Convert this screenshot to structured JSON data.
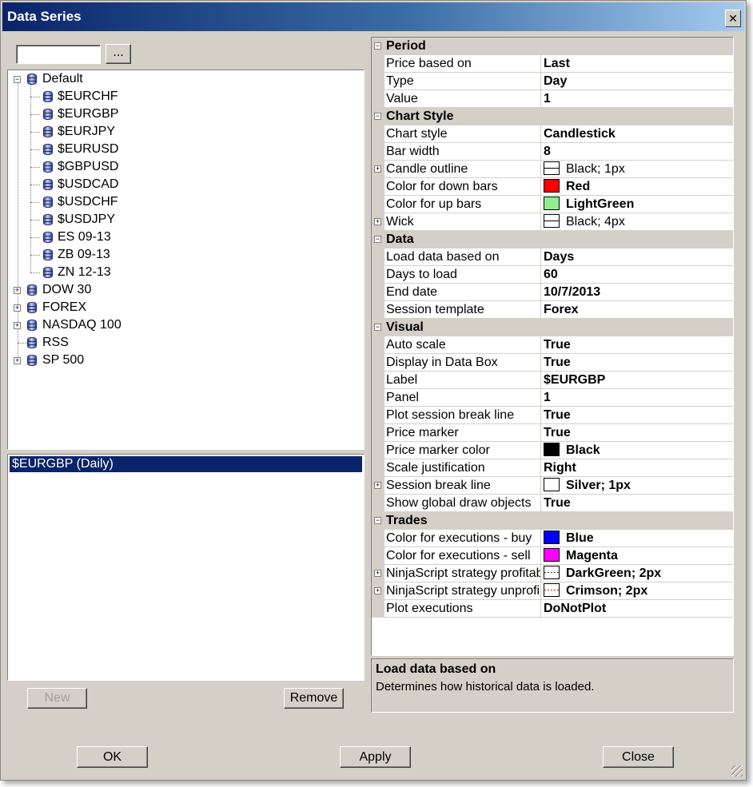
{
  "window": {
    "title": "Data Series",
    "close_glyph": "✕"
  },
  "browse_label": "...",
  "tree": {
    "expanded_group": "Default",
    "default_items": [
      "$EURCHF",
      "$EURGBP",
      "$EURJPY",
      "$EURUSD",
      "$GBPUSD",
      "$USDCAD",
      "$USDCHF",
      "$USDJPY",
      "ES 09-13",
      "ZB 09-13",
      "ZN 12-13"
    ],
    "groups": [
      {
        "label": "DOW 30",
        "expandable": true
      },
      {
        "label": "FOREX",
        "expandable": true
      },
      {
        "label": "NASDAQ 100",
        "expandable": true
      },
      {
        "label": "RSS",
        "expandable": false
      },
      {
        "label": "SP 500",
        "expandable": true
      }
    ]
  },
  "series_list": {
    "selected": "$EURGBP (Daily)"
  },
  "buttons": {
    "new": "New",
    "remove": "Remove",
    "ok": "OK",
    "apply": "Apply",
    "close": "Close"
  },
  "properties": [
    {
      "category": "Period",
      "rows": [
        {
          "name": "Price based on",
          "value": "Last"
        },
        {
          "name": "Type",
          "value": "Day"
        },
        {
          "name": "Value",
          "value": "1"
        }
      ]
    },
    {
      "category": "Chart Style",
      "rows": [
        {
          "name": "Chart style",
          "value": "Candlestick"
        },
        {
          "name": "Bar width",
          "value": "8"
        },
        {
          "name": "Candle outline",
          "value": "Black; 1px",
          "expandable": true,
          "swatch": "#ffffff",
          "line": "solid",
          "bold": false
        },
        {
          "name": "Color for down bars",
          "value": "Red",
          "swatch": "#ff0000"
        },
        {
          "name": "Color for up bars",
          "value": "LightGreen",
          "swatch": "#90ee90"
        },
        {
          "name": "Wick",
          "value": "Black; 4px",
          "expandable": true,
          "swatch": "#ffffff",
          "line": "solid",
          "bold": false
        }
      ]
    },
    {
      "category": "Data",
      "rows": [
        {
          "name": "Load data based on",
          "value": "Days"
        },
        {
          "name": "Days to load",
          "value": "60"
        },
        {
          "name": "End date",
          "value": "10/7/2013"
        },
        {
          "name": "Session template",
          "value": "Forex"
        }
      ]
    },
    {
      "category": "Visual",
      "rows": [
        {
          "name": "Auto scale",
          "value": "True"
        },
        {
          "name": "Display in Data Box",
          "value": "True"
        },
        {
          "name": "Label",
          "value": "$EURGBP"
        },
        {
          "name": "Panel",
          "value": "1"
        },
        {
          "name": "Plot session break line",
          "value": "True"
        },
        {
          "name": "Price marker",
          "value": "True"
        },
        {
          "name": "Price marker color",
          "value": "Black",
          "swatch": "#000000"
        },
        {
          "name": "Scale justification",
          "value": "Right"
        },
        {
          "name": "Session break line",
          "value": "Silver; 1px",
          "expandable": true,
          "swatch": "#ffffff",
          "line": "none"
        },
        {
          "name": "Show global draw objects",
          "value": "True"
        }
      ]
    },
    {
      "category": "Trades",
      "rows": [
        {
          "name": "Color for executions - buy",
          "value": "Blue",
          "swatch": "#0000ff"
        },
        {
          "name": "Color for executions - sell",
          "value": "Magenta",
          "swatch": "#ff00ff"
        },
        {
          "name": "NinjaScript strategy profitab",
          "value": "DarkGreen; 2px",
          "expandable": true,
          "swatch": "#ffffff",
          "line": "dotted"
        },
        {
          "name": "NinjaScript strategy unprofi",
          "value": "Crimson; 2px",
          "expandable": true,
          "swatch": "#ffffff",
          "line": "dotted-red"
        },
        {
          "name": "Plot executions",
          "value": "DoNotPlot"
        }
      ]
    }
  ],
  "description": {
    "title": "Load data based on",
    "text": "Determines how historical data is loaded."
  },
  "colors": {
    "title_start": "#0a246a",
    "title_end": "#a6caf0",
    "selection": "#0a246a",
    "chrome": "#d4d0c8"
  }
}
